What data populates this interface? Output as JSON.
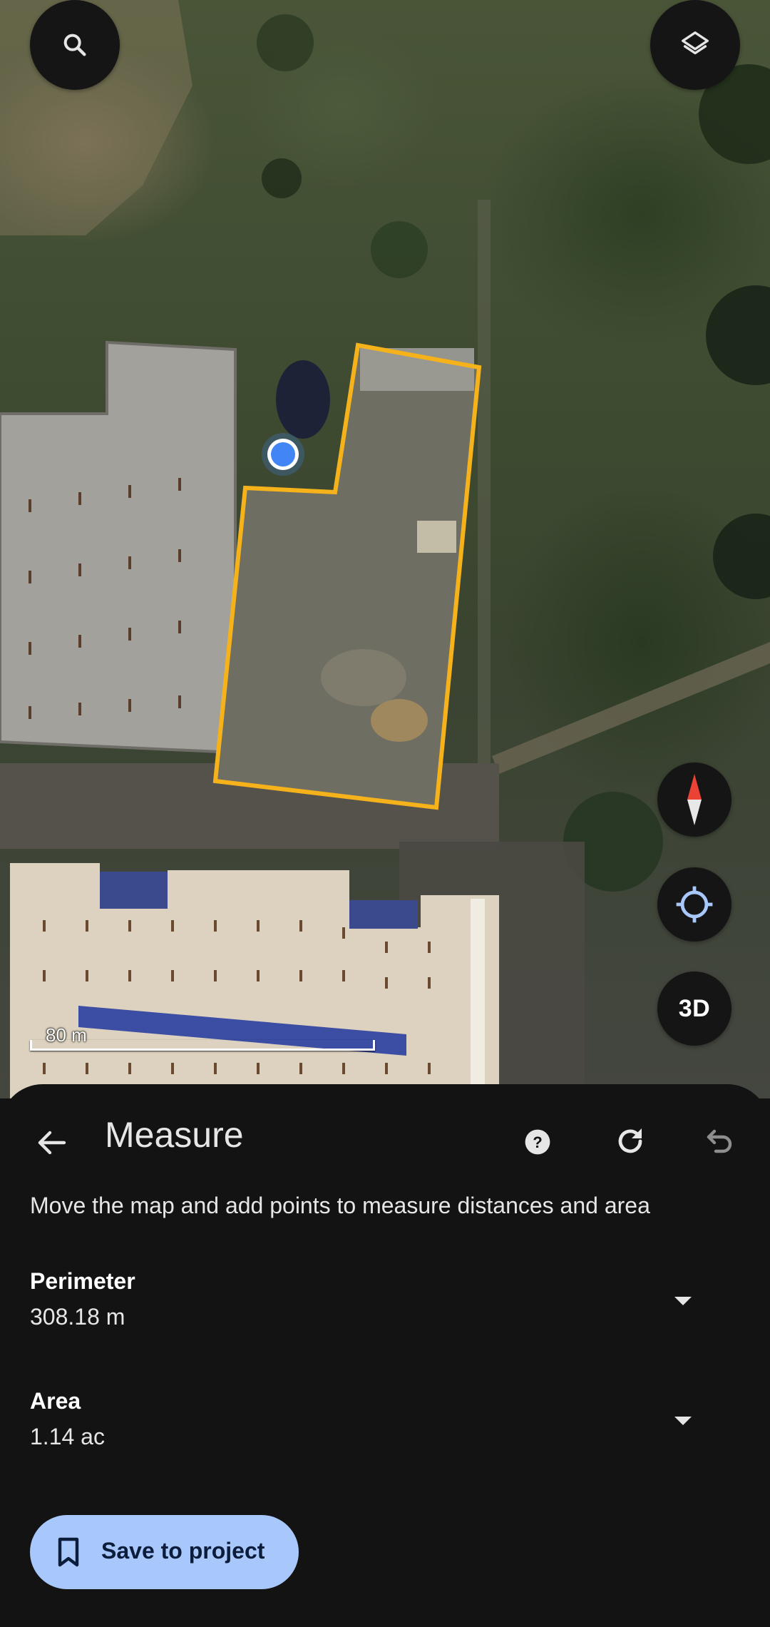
{
  "map": {
    "scale_label": "80 m",
    "controls": {
      "search_icon": "search-icon",
      "layers_icon": "layers-icon",
      "compass_icon": "compass-icon",
      "location_icon": "my-location-icon",
      "three_d_label": "3D"
    },
    "measurement_outline_color": "#f5b21a",
    "location_dot_color": "#4285f4"
  },
  "sheet": {
    "title": "Measure",
    "instruction": "Move the map and add points to measure distances and area",
    "icons": [
      "back-arrow-icon",
      "help-icon",
      "redo-icon",
      "undo-icon"
    ],
    "metrics": [
      {
        "label": "Perimeter",
        "value": "308.18 m"
      },
      {
        "label": "Area",
        "value": "1.14 ac"
      }
    ],
    "save_button_label": "Save to project",
    "accent_color": "#a8c7fa"
  }
}
